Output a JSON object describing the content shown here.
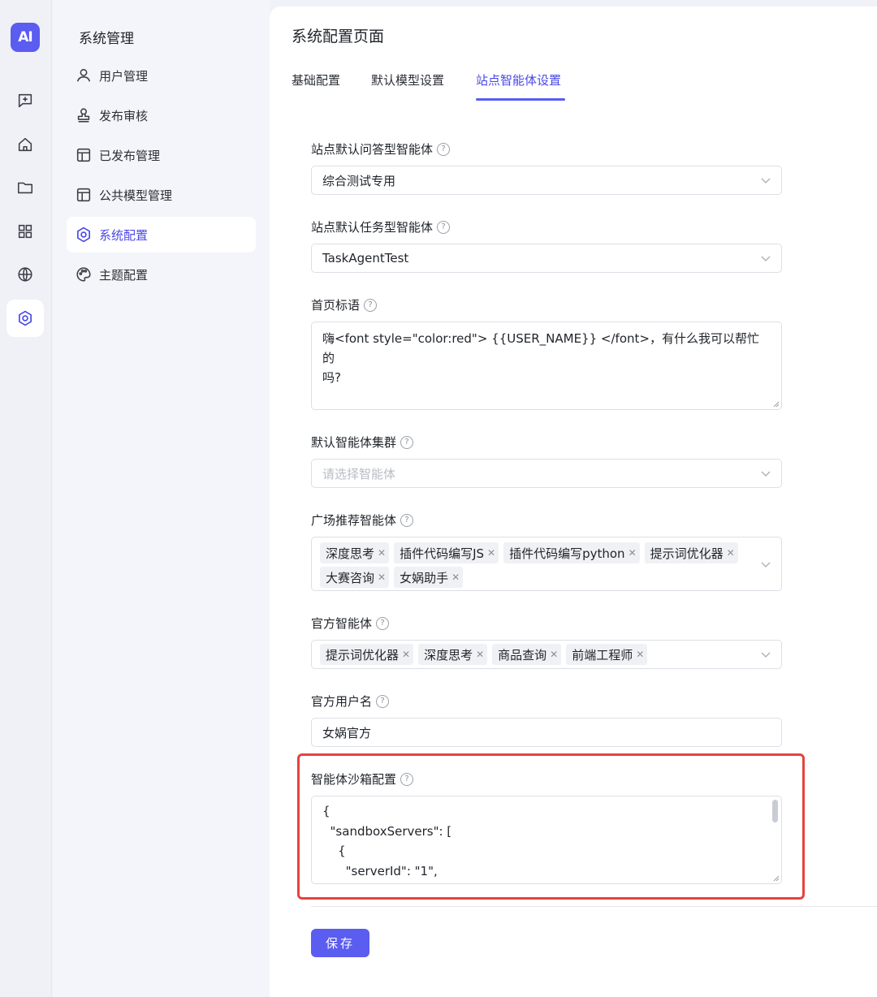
{
  "rail": {
    "logo_text": "AI",
    "icons": [
      "chat-plus-icon",
      "home-icon",
      "folder-icon",
      "grid-icon",
      "globe-icon",
      "settings-icon"
    ],
    "accent": "#5b5cf0"
  },
  "sidebar": {
    "title": "系统管理",
    "items": [
      {
        "label": "用户管理",
        "icon": "user-icon"
      },
      {
        "label": "发布审核",
        "icon": "stamp-icon"
      },
      {
        "label": "已发布管理",
        "icon": "layout-icon"
      },
      {
        "label": "公共模型管理",
        "icon": "layout-icon"
      },
      {
        "label": "系统配置",
        "icon": "gear-icon",
        "active": true
      },
      {
        "label": "主题配置",
        "icon": "palette-icon"
      }
    ]
  },
  "main": {
    "title": "系统配置页面",
    "tabs": [
      {
        "label": "基础配置"
      },
      {
        "label": "默认模型设置"
      },
      {
        "label": "站点智能体设置",
        "active": true
      }
    ],
    "fields": {
      "qa_agent": {
        "label": "站点默认问答型智能体",
        "value": "综合测试专用"
      },
      "task_agent": {
        "label": "站点默认任务型智能体",
        "value": "TaskAgentTest"
      },
      "slogan": {
        "label": "首页标语",
        "value_line1": "嗨<font style=\"color:red\"> {{USER_NAME}} </font>，有什么我可以帮忙的",
        "value_line2": "吗?"
      },
      "cluster": {
        "label": "默认智能体集群",
        "placeholder": "请选择智能体"
      },
      "square": {
        "label": "广场推荐智能体",
        "tags": [
          "深度思考",
          "插件代码编写JS",
          "插件代码编写python",
          "提示词优化器",
          "大赛咨询",
          "女娲助手"
        ]
      },
      "official": {
        "label": "官方智能体",
        "tags": [
          "提示词优化器",
          "深度思考",
          "商品查询",
          "前端工程师"
        ]
      },
      "official_user": {
        "label": "官方用户名",
        "value": "女娲官方"
      },
      "sandbox": {
        "label": "智能体沙箱配置",
        "lines": [
          "{",
          "  \"sandboxServers\": [",
          "    {",
          "      \"serverId\": \"1\","
        ]
      }
    },
    "help_glyph": "?",
    "tag_close_glyph": "✕",
    "save_label": "保存",
    "highlight_color": "#e5433e"
  }
}
